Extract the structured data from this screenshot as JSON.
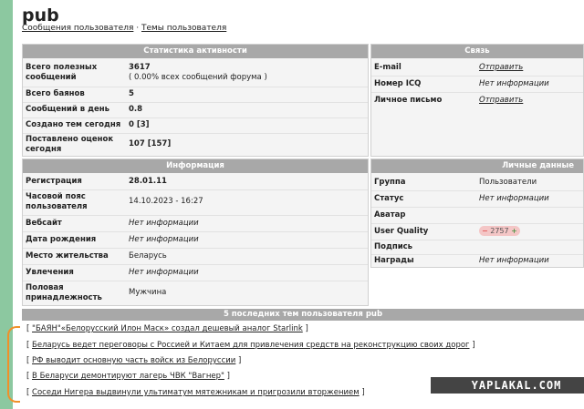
{
  "user": {
    "name": "pub",
    "links": {
      "posts": "Сообщения пользователя",
      "separator": " · ",
      "topics": "Темы пользователя"
    }
  },
  "stats": {
    "header": "Статистика активности",
    "rows": [
      {
        "label": "Всего полезных сообщений",
        "value": "3617",
        "sub": "( 0.00% всех сообщений форума )"
      },
      {
        "label": "Всего баянов",
        "value": "5"
      },
      {
        "label": "Сообщений в день",
        "value": "0.8"
      },
      {
        "label": "Создано тем сегодня",
        "value": "0 [3]"
      },
      {
        "label": "Поставлено оценок сегодня",
        "value": "107 [157]"
      }
    ]
  },
  "contact": {
    "header": "Связь",
    "rows": [
      {
        "label": "E-mail",
        "value": "Отправить"
      },
      {
        "label": "Номер ICQ",
        "value": "Нет информации"
      },
      {
        "label": "Личное письмо",
        "value": "Отправить"
      }
    ]
  },
  "info": {
    "header": "Информация",
    "rows": [
      {
        "label": "Регистрация",
        "value": "28.01.11"
      },
      {
        "label": "Часовой пояс пользователя",
        "value": "14.10.2023 - 16:27"
      },
      {
        "label": "Вебсайт",
        "value": "Нет информации"
      },
      {
        "label": "Дата рождения",
        "value": "Нет информации"
      },
      {
        "label": "Место жительства",
        "value": "Беларусь"
      },
      {
        "label": "Увлечения",
        "value": "Нет информации"
      },
      {
        "label": "Половая принадлежность",
        "value": "Мужчина"
      }
    ]
  },
  "personal": {
    "header": "Личные данные",
    "rows": [
      {
        "label": "Группа",
        "value": "Пользователи"
      },
      {
        "label": "Статус",
        "value": "Нет информации"
      },
      {
        "label": "Аватар",
        "value": ""
      },
      {
        "label": "User Quality",
        "minus": "−",
        "value": "2757",
        "plus": "+"
      },
      {
        "label": "Подпись",
        "value": ""
      },
      {
        "label": "Награды",
        "value": "Нет информации"
      }
    ]
  },
  "topics": {
    "header": "5 последних тем пользователя pub",
    "open": "[ ",
    "close": " ]",
    "items": [
      "\"БАЯН\"«Белорусский Илон Маск» создал дешевый аналог Starlink",
      "Беларусь ведет переговоры с Россией и Китаем для привлечения средств на реконструкцию своих дорог",
      "РФ выводит основную часть войск из Белоруссии",
      "В Беларуси демонтируют лагерь ЧВК \"Вагнер\"",
      "Соседи Нигера выдвинули ультиматум мятежникам и пригрозили вторжением"
    ]
  },
  "watermark": "YAPLAKAL.COM",
  "colors": {
    "header_bg": "#a8a8a8",
    "panel_bg": "#f4f4f4",
    "green_bar": "#8cc8a0",
    "annotation": "#f0902a"
  }
}
